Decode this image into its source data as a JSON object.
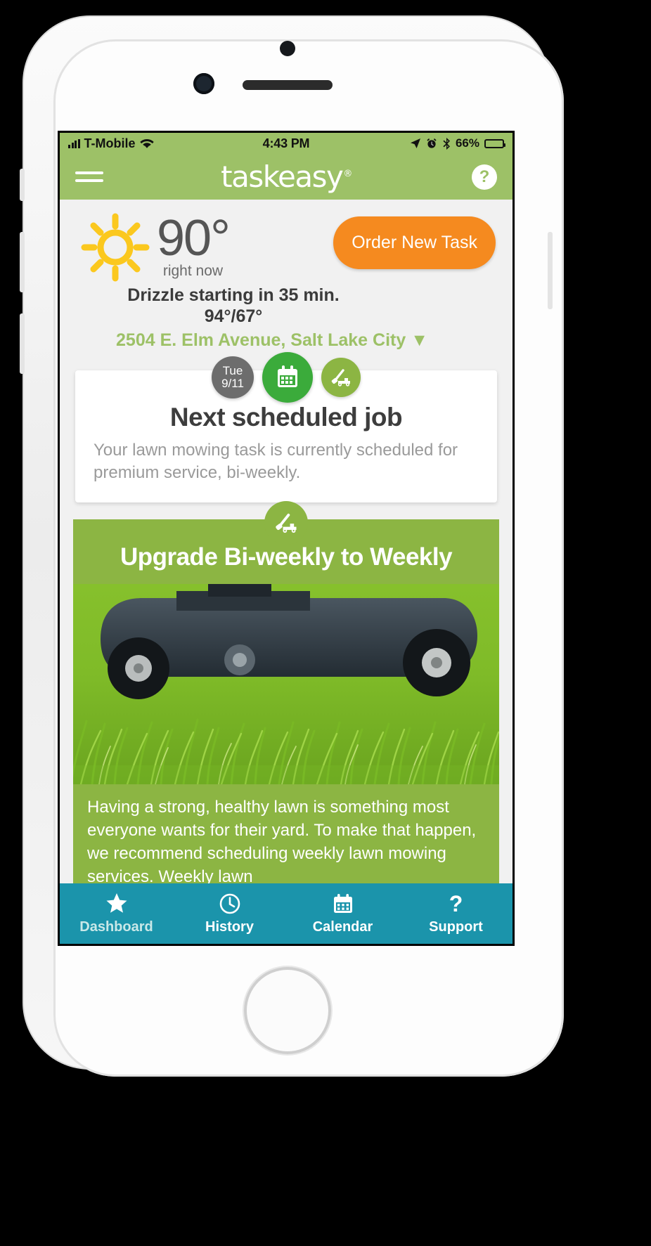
{
  "status_bar": {
    "carrier": "T-Mobile",
    "wifi_icon": "wifi-icon",
    "signal_icon": "signal-bars-icon",
    "time": "4:43 PM",
    "location_icon": "location-arrow-icon",
    "alarm_icon": "alarm-clock-icon",
    "bluetooth_icon": "bluetooth-icon",
    "battery_percent": "66%",
    "battery_icon": "battery-icon"
  },
  "app_bar": {
    "menu_icon": "hamburger-menu-icon",
    "brand": "taskeasy",
    "brand_registered": "®",
    "help_label": "?"
  },
  "weather": {
    "condition_icon": "sun-icon",
    "temperature": "90°",
    "temperature_caption": "right now",
    "forecast": "Drizzle starting in 35 min.",
    "high_low": "94°/67°",
    "address": "2504 E. Elm Avenue, Salt Lake City",
    "address_chevron": "▼",
    "order_button": "Order New Task"
  },
  "next_job": {
    "date_weekday": "Tue",
    "date_value": "9/11",
    "calendar_icon": "calendar-icon",
    "mower_icon": "lawn-mower-icon",
    "title": "Next scheduled job",
    "description": "Your lawn mowing task is currently scheduled for premium service, bi-weekly."
  },
  "promo": {
    "mower_icon": "lawn-mower-icon",
    "title": "Upgrade Bi-weekly to Weekly",
    "image_alt": "lawn-mower-in-grass-photo",
    "body": "Having a strong, healthy lawn is something most everyone wants for their yard. To make that happen, we recommend scheduling weekly lawn mowing services. Weekly lawn"
  },
  "tab_bar": {
    "tabs": [
      {
        "label": "Dashboard",
        "icon": "star-icon",
        "active": true
      },
      {
        "label": "History",
        "icon": "clock-icon",
        "active": false
      },
      {
        "label": "Calendar",
        "icon": "calendar-icon",
        "active": false
      },
      {
        "label": "Support",
        "icon": "question-mark-icon",
        "active": false
      }
    ]
  },
  "colors": {
    "brand_green": "#9dc167",
    "accent_orange": "#f58a1f",
    "promo_green": "#8cb543",
    "calendar_green": "#3bab3b",
    "tabbar_teal": "#1b94ab",
    "sun_yellow": "#fbc81e"
  }
}
